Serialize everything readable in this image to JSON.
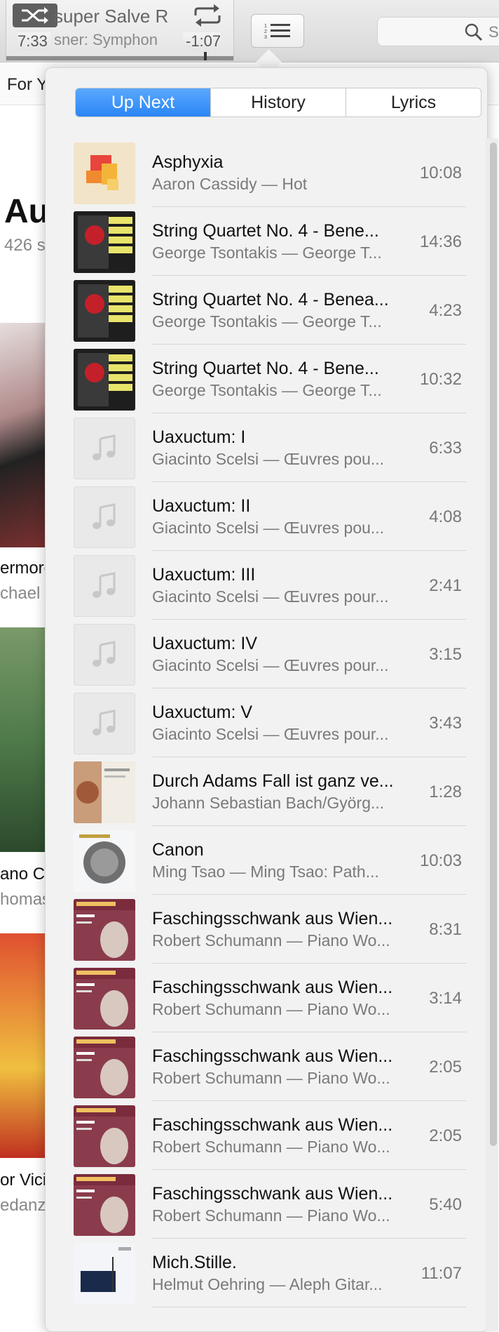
{
  "toolbar": {
    "now_playing_title": "super Salve R",
    "now_playing_artist": "sner: Symphon",
    "elapsed": "7:33",
    "remaining": "-1:07",
    "progress": 0.87,
    "search_placeholder": "S"
  },
  "background": {
    "nav_item": "For Yo",
    "page_title": "Au",
    "page_subtitle": "426 s",
    "labels": [
      {
        "text": "ermore",
        "sub": "chael"
      },
      {
        "text": "ano Con",
        "sub": "homas"
      },
      {
        "text": "or Vici",
        "sub": "edanz"
      }
    ]
  },
  "popover": {
    "tabs": [
      {
        "label": "Up Next",
        "active": true
      },
      {
        "label": "History",
        "active": false
      },
      {
        "label": "Lyrics",
        "active": false
      }
    ],
    "rows": [
      {
        "title": "Asphyxia",
        "subtitle": "Aaron Cassidy — Hot",
        "duration": "10:08",
        "art": "hot"
      },
      {
        "title": "String Quartet No. 4 - Bene...",
        "subtitle": "George Tsontakis — George T...",
        "duration": "14:36",
        "art": "quartet"
      },
      {
        "title": "String Quartet No. 4 - Benea...",
        "subtitle": "George Tsontakis — George T...",
        "duration": "4:23",
        "art": "quartet"
      },
      {
        "title": "String Quartet No. 4 - Bene...",
        "subtitle": "George Tsontakis — George T...",
        "duration": "10:32",
        "art": "quartet"
      },
      {
        "title": "Uaxuctum: I",
        "subtitle": "Giacinto Scelsi — Œuvres pou...",
        "duration": "6:33",
        "art": "placeholder"
      },
      {
        "title": "Uaxuctum: II",
        "subtitle": "Giacinto Scelsi — Œuvres pou...",
        "duration": "4:08",
        "art": "placeholder"
      },
      {
        "title": "Uaxuctum: III",
        "subtitle": "Giacinto Scelsi — Œuvres pour...",
        "duration": "2:41",
        "art": "placeholder"
      },
      {
        "title": "Uaxuctum: IV",
        "subtitle": "Giacinto Scelsi — Œuvres pour...",
        "duration": "3:15",
        "art": "placeholder"
      },
      {
        "title": "Uaxuctum: V",
        "subtitle": "Giacinto Scelsi — Œuvres pour...",
        "duration": "3:43",
        "art": "placeholder"
      },
      {
        "title": "Durch Adams Fall ist ganz ve...",
        "subtitle": "Johann Sebastian Bach/Györg...",
        "duration": "1:28",
        "art": "bach"
      },
      {
        "title": "Canon",
        "subtitle": "Ming Tsao — Ming Tsao: Path...",
        "duration": "10:03",
        "art": "tsao"
      },
      {
        "title": "Faschingsschwank aus Wien...",
        "subtitle": "Robert Schumann — Piano Wo...",
        "duration": "8:31",
        "art": "schumann"
      },
      {
        "title": "Faschingsschwank aus Wien...",
        "subtitle": "Robert Schumann — Piano Wo...",
        "duration": "3:14",
        "art": "schumann"
      },
      {
        "title": "Faschingsschwank aus Wien...",
        "subtitle": "Robert Schumann — Piano Wo...",
        "duration": "2:05",
        "art": "schumann"
      },
      {
        "title": "Faschingsschwank aus Wien...",
        "subtitle": "Robert Schumann — Piano Wo...",
        "duration": "2:05",
        "art": "schumann"
      },
      {
        "title": "Faschingsschwank aus Wien...",
        "subtitle": "Robert Schumann — Piano Wo...",
        "duration": "5:40",
        "art": "schumann"
      },
      {
        "title": "Mich.Stille.",
        "subtitle": "Helmut Oehring — Aleph Gitar...",
        "duration": "11:07",
        "art": "oehring"
      }
    ]
  },
  "colors": {
    "accent": "#2a86f4",
    "row_title": "#111111",
    "row_subtitle": "#7a7a7a"
  }
}
